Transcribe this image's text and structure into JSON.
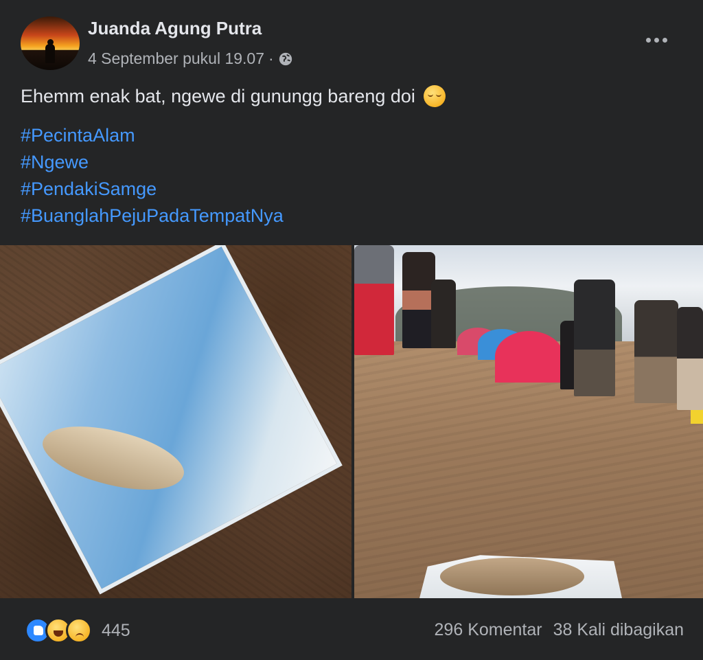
{
  "post": {
    "author": "Juanda Agung Putra",
    "timestamp": "4 September pukul 19.07",
    "separator": "·",
    "privacy_icon": "globe-icon",
    "text": "Ehemm enak bat, ngewe di gunungg bareng doi",
    "emoji": "relieved-face-emoji",
    "hashtags": [
      "#PecintaAlam",
      "#Ngewe",
      "#PendakiSamge",
      "#BuanglahPejuPadaTempatNya"
    ]
  },
  "photos": {
    "count": 2
  },
  "footer": {
    "reaction_icons": [
      "like-icon",
      "haha-icon",
      "sad-icon"
    ],
    "reaction_count": "445",
    "comments": "296 Komentar",
    "shares": "38 Kali dibagikan"
  },
  "colors": {
    "background": "#242526",
    "primary_text": "#e4e6eb",
    "secondary_text": "#b0b3b8",
    "hashtag": "#4599ff",
    "like": "#2d88ff"
  }
}
